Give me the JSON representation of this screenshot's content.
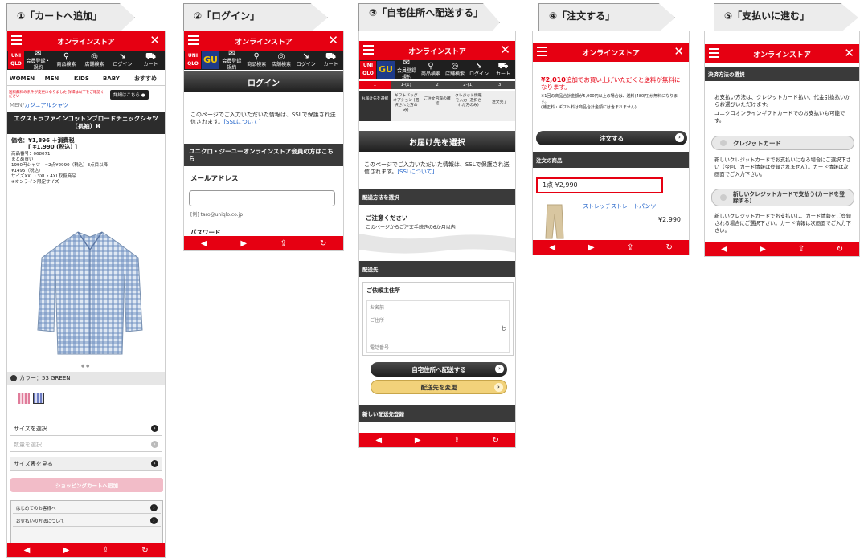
{
  "steps": [
    {
      "label": "①「カートへ追加」"
    },
    {
      "label": "②「ログイン」"
    },
    {
      "label": "③「自宅住所へ配送する」"
    },
    {
      "label": "④「注文する」"
    },
    {
      "label": "⑤「支払いに進む」"
    }
  ],
  "header": {
    "title": "オンラインストア",
    "close": "✕"
  },
  "iconbar": {
    "uniqlo_logo": "UNI QLO",
    "gu_logo": "GU",
    "items": [
      "会員登録・規約",
      "商品検索",
      "店舗検索",
      "ログイン",
      "カート"
    ],
    "items_short": [
      "会員登録 規約",
      "商品検索",
      "店舗検索",
      "ログイン",
      "カート"
    ]
  },
  "bottom_bar": {
    "back": "◀",
    "forward": "▶",
    "share": "⇪",
    "reload": "↻"
  },
  "screen1": {
    "categories": [
      "WOMEN",
      "MEN",
      "KIDS",
      "BABY",
      "おすすめ"
    ],
    "notice": "送料無料の条件が変更になりました 詳細は以下をご確認ください",
    "notice_button": "詳細はこちら ●",
    "breadcrumb_root": "MEN/",
    "breadcrumb_link": "カジュアルシャツ",
    "product_title": "エクストラファインコットンブロードチェックシャツ（長袖）B",
    "price_line1": "価格：¥1,896 ＋消費税",
    "price_line2": "[ ¥1,990 (税込) ]",
    "code": "商品番号：068071",
    "bulk1": "まとめ買い",
    "bulk2": "1990円シャツ　~2点¥2990（税込）3点目以降",
    "bulk3": "¥1495（税込）",
    "size_note": "サイズXXL・3XL・4XL取扱商品",
    "online_only": "※オンライン限定サイズ",
    "color_label": "カラー：53 GREEN",
    "select_size": "サイズを選択",
    "select_qty": "数量を選択",
    "size_chart": "サイズ表を見る",
    "add_to_cart": "ショッピングカートへ追加",
    "help1": "はじめてのお客様へ",
    "help2": "お支払いの方法について"
  },
  "screen2": {
    "title": "ログイン",
    "ssl_text": "このページでご入力いただいた情報は、SSLで保護され送信されます。",
    "ssl_link": "[SSLについて]",
    "member_heading": "ユニクロ・ジーユーオンラインストア会員の方はこちら",
    "email_label": "メールアドレス",
    "email_example": "[例] taro@uniqlo.co.jp",
    "password_label": "パスワード"
  },
  "screen3": {
    "progress": [
      "1",
      "1-(1)",
      "2",
      "2-(1)",
      "3"
    ],
    "tabs": [
      "お届け先を選択",
      "ギフトバッグ オプション (選択された方のみ)",
      "ご注文内容の確認",
      "クレジット情報を入力 (選択された方のみ)",
      "注文完了"
    ],
    "title": "お届け先を選択",
    "ssl_text": "このページでご入力いただいた情報は、SSLで保護され送信されます。",
    "ssl_link": "[SSLについて]",
    "ship_method": "配送方法を選択",
    "caution": "ご注意ください",
    "caution_sub": "このページからご注文手続きの6か月以内",
    "ship_to": "配送先",
    "home_addr": "ご依頼主住所",
    "field_name": "お名前",
    "field_addr": "ご住所",
    "field_tel": "電話番号",
    "addr_side": "七",
    "deliver_home": "自宅住所へ配送する",
    "change_dest": "配送先を変更",
    "new_dest": "新しい配送先登録"
  },
  "screen4": {
    "free_ship_amount": "¥2,010",
    "free_ship_text": "追加でお買い上げいただくと送料が無料になります。",
    "note1": "※1回の商品合計金額が5,000円以上の場合は、送料(480円)が無料になります。",
    "note2": "(補正料・ギフト料は商品合計金額には含まれません)",
    "order_button": "注文する",
    "ordered_items": "注文の商品",
    "count_total": "1点 ¥2,990",
    "item_name": "ストレッチストレートパンツ",
    "item_price": "¥2,990"
  },
  "screen5": {
    "heading": "決済方法の選択",
    "intro": "お支払い方法は、クレジットカード払い、代金引換払いからお選びいただけます。",
    "intro2": "ユニクロオンラインギフトカードでのお支払いも可能です。",
    "credit_option": "クレジットカード",
    "credit_note": "新しいクレジットカードでお支払いになる場合にご選択下さい（今回、カード情報は登録されません）。カード情報は次画面でご入力下さい。",
    "new_card_option": "新しいクレジットカードで支払う(カードを登録する)",
    "new_card_note": "新しいクレジットカードでお支払いし、カード情報をご登録される場合にご選択下さい。カード情報は次画面でご入力下さい。"
  },
  "colors": {
    "brand_red": "#e60012",
    "dark": "#2c2c2c",
    "link_blue": "#1a5ec8",
    "gold_button": "#f2d27a"
  }
}
